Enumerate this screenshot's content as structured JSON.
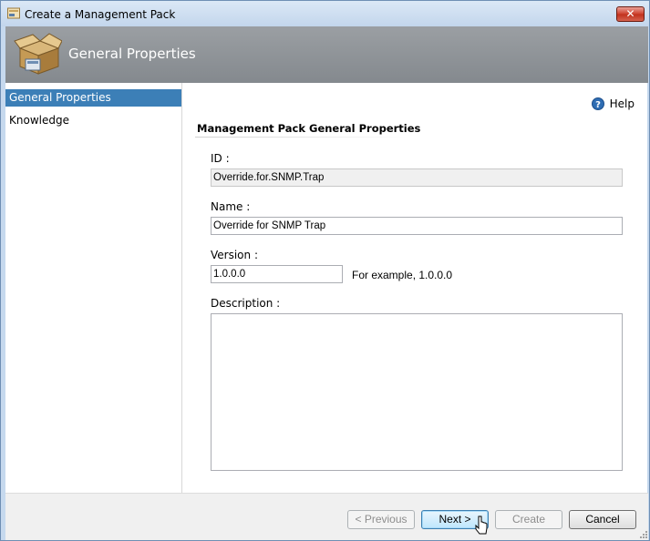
{
  "window": {
    "title": "Create a Management Pack",
    "close_label": "✕"
  },
  "banner": {
    "title": "General Properties"
  },
  "sidebar": {
    "items": [
      {
        "label": "General Properties"
      },
      {
        "label": "Knowledge"
      }
    ]
  },
  "content": {
    "help_label": "Help",
    "section_title": "Management Pack General Properties",
    "id": {
      "label": "ID :",
      "value": "Override.for.SNMP.Trap"
    },
    "name": {
      "label": "Name :",
      "value": "Override for SNMP Trap"
    },
    "version": {
      "label": "Version :",
      "value": "1.0.0.0",
      "example": "For example, 1.0.0.0"
    },
    "description": {
      "label": "Description :",
      "value": ""
    }
  },
  "footer": {
    "previous": "< Previous",
    "next": "Next >",
    "create": "Create",
    "cancel": "Cancel"
  },
  "colors": {
    "selection": "#3c7fb7",
    "banner": "#8e9297",
    "close_button": "#c7392a"
  }
}
